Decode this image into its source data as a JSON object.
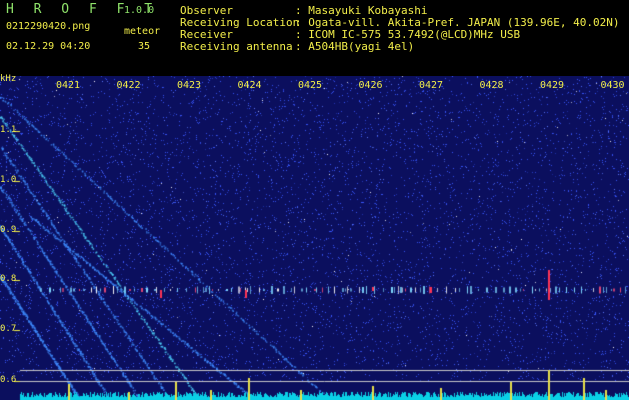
{
  "header": {
    "app_name": "H R O F F T",
    "version": "1.0.0",
    "filename": "0212290420.png",
    "datetime": "02.12.29 04:20",
    "meteor_label": "meteor",
    "meteor_count": "35",
    "observer_label": "Observer",
    "observer_value": ": Masayuki Kobayashi",
    "location_label": "Receiving Location",
    "location_value": ": Ogata-vill. Akita-Pref. JAPAN (139.96E, 40.02N)",
    "receiver_label": "Receiver",
    "receiver_value": ": ICOM IC-575 53.7492(@LCD)MHz USB",
    "antenna_label": "Receiving antenna",
    "antenna_value": ": A504HB(yagi 4el)"
  },
  "spectrogram": {
    "unit_label": "kHz",
    "freq_labels": [
      "1.1",
      "1.0",
      "0.9",
      "0.8",
      "0.7",
      "0.6"
    ],
    "time_labels": [
      "0421",
      "0422",
      "0423",
      "0424",
      "0425",
      "0426",
      "0427",
      "0428",
      "0429",
      "0430"
    ],
    "colors": {
      "background": "#0b0f5e",
      "noise": "#3a58ff",
      "trail": "#4fd6ff",
      "echo": "#ffffff",
      "label": "#f2ee4a",
      "bar": "#0ad0e6"
    }
  }
}
